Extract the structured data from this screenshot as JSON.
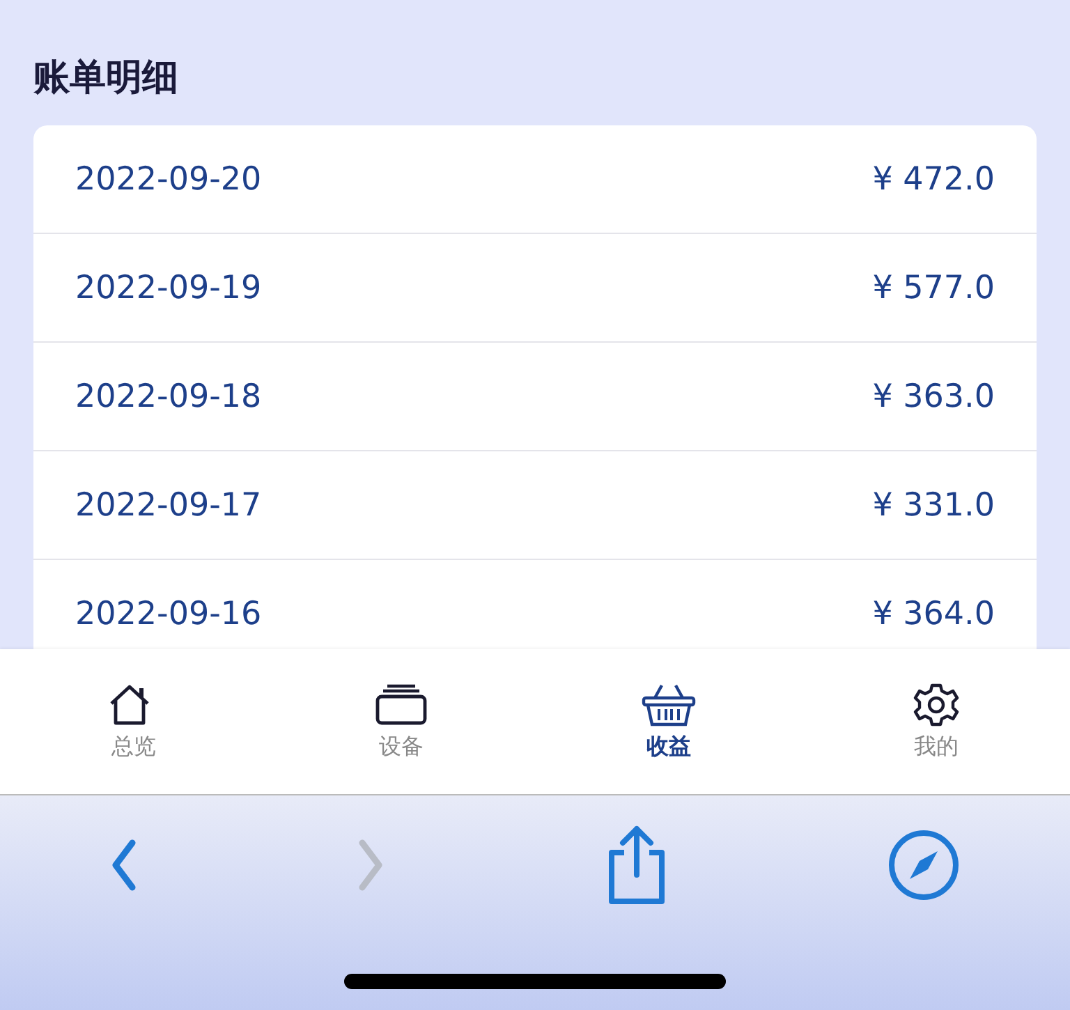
{
  "title": "账单明细",
  "bills": [
    {
      "date": "2022-09-20",
      "amount": "¥ 472.0"
    },
    {
      "date": "2022-09-19",
      "amount": "¥ 577.0"
    },
    {
      "date": "2022-09-18",
      "amount": "¥ 363.0"
    },
    {
      "date": "2022-09-17",
      "amount": "¥ 331.0"
    },
    {
      "date": "2022-09-16",
      "amount": "¥ 364.0"
    }
  ],
  "tabs": [
    {
      "kind": "home",
      "label": "总览",
      "selected": false
    },
    {
      "kind": "devices",
      "label": "设备",
      "selected": false
    },
    {
      "kind": "basket",
      "label": "收益",
      "selected": true
    },
    {
      "kind": "gear",
      "label": "我的",
      "selected": false
    }
  ],
  "browser_toolbar": [
    {
      "kind": "back",
      "disabled": false
    },
    {
      "kind": "forward",
      "disabled": true
    },
    {
      "kind": "share",
      "disabled": false
    },
    {
      "kind": "compass",
      "disabled": false
    }
  ]
}
